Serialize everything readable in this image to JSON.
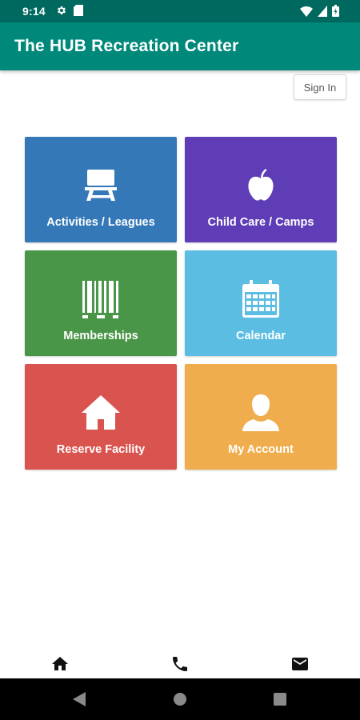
{
  "status_bar": {
    "time": "9:14",
    "icons_left": [
      "gear-icon",
      "sd-card-icon"
    ],
    "icons_right": [
      "wifi-icon",
      "signal-icon",
      "battery-icon"
    ]
  },
  "app_bar": {
    "title": "The HUB Recreation Center",
    "color": "#00897b"
  },
  "sign_in": {
    "label": "Sign In"
  },
  "tiles": [
    {
      "label": "Activities / Leagues",
      "icon": "picnic-table-icon",
      "color": "#3478b8"
    },
    {
      "label": "Child Care / Camps",
      "icon": "apple-icon",
      "color": "#5e3db6"
    },
    {
      "label": "Memberships",
      "icon": "barcode-icon",
      "color": "#4a9648"
    },
    {
      "label": "Calendar",
      "icon": "calendar-icon",
      "color": "#5bbde1"
    },
    {
      "label": "Reserve Facility",
      "icon": "house-icon",
      "color": "#d9534f"
    },
    {
      "label": "My Account",
      "icon": "person-icon",
      "color": "#efad4d"
    }
  ],
  "bottom_nav": {
    "items": [
      "home-icon",
      "phone-icon",
      "mail-icon"
    ]
  },
  "system_nav": {
    "items": [
      "back-icon",
      "home-circle-icon",
      "recents-icon"
    ]
  }
}
